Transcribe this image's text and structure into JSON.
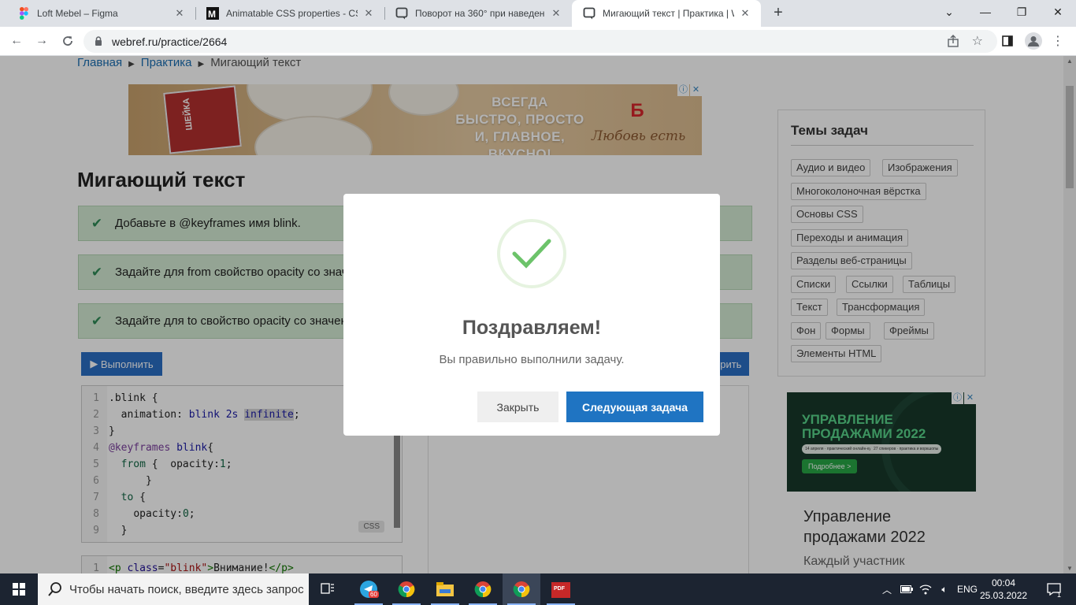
{
  "browser": {
    "tabs": [
      {
        "title": "Loft Mebel – Figma",
        "icon": "figma-icon"
      },
      {
        "title": "Animatable CSS properties - CSS",
        "icon": "mdn-icon"
      },
      {
        "title": "Поворот на 360° при наведении",
        "icon": "webref-icon"
      },
      {
        "title": "Мигающий текст | Практика | W",
        "icon": "webref-icon",
        "active": true
      }
    ],
    "url": "webref.ru/practice/2664"
  },
  "breadcrumb": {
    "home": "Главная",
    "practice": "Практика",
    "current": "Мигающий текст"
  },
  "banner1": {
    "slogan_line1": "ВСЕГДА",
    "slogan_line2": "БЫСТРО, ПРОСТО",
    "slogan_line3": "И, ГЛАВНОЕ, ВКУСНО!",
    "package_text": "ШЕЙКА",
    "logo_letter": "Б",
    "tagline": "Любовь есть"
  },
  "page_title": "Мигающий текст",
  "tasks": [
    "Добавьте в @keyframes имя blink.",
    "Задайте для from свойство opacity со значением 1.",
    "Задайте для to свойство opacity со значением 0."
  ],
  "run_label": "Выполнить",
  "check_label": "ерить",
  "css_tag": "CSS",
  "code_lines": [
    "1",
    "2",
    "3",
    "4",
    "5",
    "6",
    "7",
    "8",
    "9"
  ],
  "html_line": {
    "num": "1"
  },
  "sidebar": {
    "title": "Темы задач",
    "topics": [
      "Аудио и видео",
      "Изображения",
      "Многоколоночная вёрстка",
      "Основы CSS",
      "Переходы и анимация",
      "Разделы веб-страницы",
      "Списки",
      "Ссылки",
      "Таблицы",
      "Текст",
      "Трансформация",
      "Фон",
      "Формы",
      "Фреймы",
      "Элементы HTML"
    ]
  },
  "ad2": {
    "banner_title_1": "УПРАВЛЕНИЕ",
    "banner_title_2": "ПРОДАЖАМИ 2022",
    "pill_1": "14 апреля · практический онлайн-курс",
    "pill_2": "27 спикеров · практика и воркшопы",
    "more": "Подробнее >",
    "heading_1": "Управление",
    "heading_2": "продажами 2022",
    "sub": "Каждый участник"
  },
  "modal": {
    "title": "Поздравляем!",
    "text": "Вы правильно выполнили задачу.",
    "close": "Закрыть",
    "next": "Следующая задача"
  },
  "taskbar": {
    "search_placeholder": "Чтобы начать поиск, введите здесь запрос",
    "telegram_badge": "60",
    "lang": "ENG",
    "time": "00:04",
    "date": "25.03.2022",
    "notif_count": "1"
  },
  "colors": {
    "accent": "#2a6fc4",
    "task_bg": "#d4ebd4",
    "check_green": "#6cc36a"
  }
}
